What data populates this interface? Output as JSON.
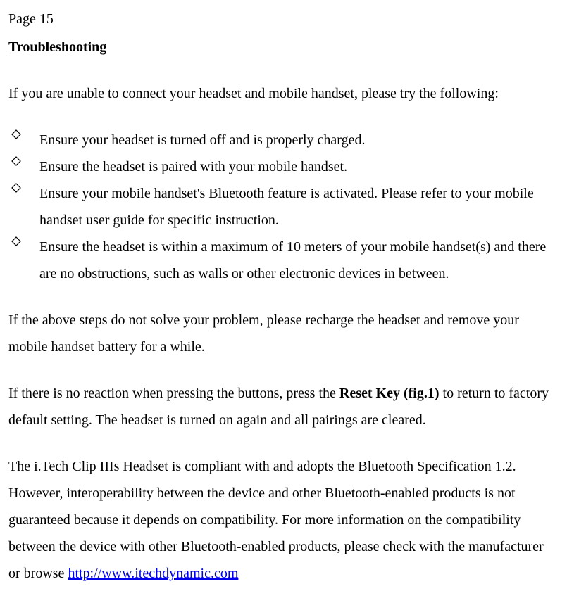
{
  "page_label": "Page 15",
  "heading": "Troubleshooting",
  "intro": "If you are unable to connect your headset and mobile handset, please try the following:",
  "bullets": [
    "Ensure your headset is turned off and is properly charged.",
    "Ensure the headset is paired with your mobile handset.",
    "Ensure your mobile handset's Bluetooth feature is activated. Please refer to your mobile handset user guide for specific instruction.",
    "Ensure the headset is within a maximum of 10 meters of your mobile handset(s) and there are no obstructions, such as walls or other electronic devices in between."
  ],
  "para_after_bullets": "If the above steps do not solve your problem, please recharge the headset and remove your mobile handset battery for a while.",
  "reset_para": {
    "before": "If there is no reaction when pressing the buttons, press the ",
    "bold": "Reset Key (fig.1)",
    "after": " to return to factory default setting. The headset is turned on again and all pairings are cleared."
  },
  "compliance_para": {
    "before": "The i.Tech Clip IIIs Headset is compliant with and adopts the Bluetooth Specification 1.2. However, interoperability between the device and other Bluetooth-enabled products is not guaranteed because it depends on compatibility. For more information on the compatibility between the device with other Bluetooth-enabled products, please check with the manufacturer or browse ",
    "link_text": "http://www.itechdynamic.com"
  }
}
